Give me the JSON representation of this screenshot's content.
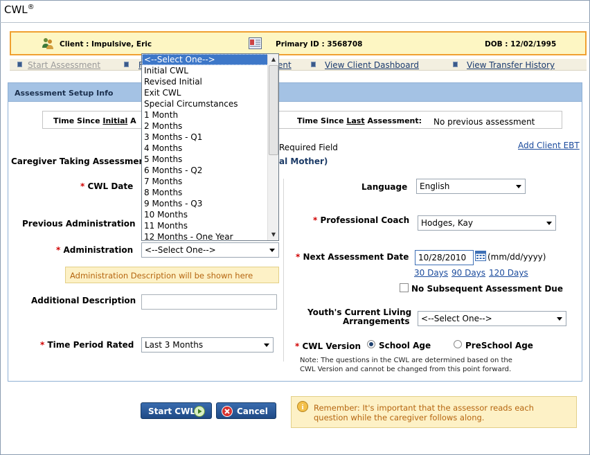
{
  "app": {
    "title": "CWL",
    "reg_mark": "®"
  },
  "client_bar": {
    "client_label": "Client : Impulsive, Eric",
    "primary_id_label": "Primary ID : 3568708",
    "dob_label": "DOB : 12/02/1995"
  },
  "nav": {
    "start_assessment": "Start Assessment",
    "item2_partial": "F",
    "item3_partial": "ent",
    "view_client_dashboard": "View Client Dashboard",
    "view_transfer_history": "View Transfer History"
  },
  "panel": {
    "header": "Assessment Setup Info"
  },
  "since": {
    "left_prefix": "Time Since",
    "left_link": "Initial",
    "left_rest": "A",
    "right_prefix": "Time Since",
    "right_link": "Last",
    "right_label": "Assessment:",
    "right_value": "No previous assessment"
  },
  "required_note": "Required Field",
  "add_client_ebt": "Add Client EBT",
  "caregiver": {
    "label": "Caregiver Taking Assessmen",
    "value_partial": "al Mother)"
  },
  "fields": {
    "cwl_date": "CWL Date",
    "previous_administration": "Previous Administration",
    "administration": "Administration",
    "administration_value": "<--Select One-->",
    "administration_description": "Administration Description will be shown here",
    "additional_description": "Additional Description",
    "time_period_rated": "Time Period Rated",
    "time_period_value": "Last 3 Months",
    "language": "Language",
    "language_value": "English",
    "professional_coach": "Professional Coach",
    "professional_coach_value": "Hodges, Kay",
    "next_assessment_date": "Next Assessment Date",
    "next_assessment_value": "10/28/2010",
    "date_format": "(mm/dd/yyyy)",
    "quick_30": "30 Days",
    "quick_90": "90 Days",
    "quick_120": "120 Days",
    "no_subsequent": "No Subsequent Assessment Due",
    "living_line1": "Youth's Current Living",
    "living_line2": "Arrangements",
    "living_value": "<--Select One-->",
    "cwl_version": "CWL Version",
    "school_age": "School Age",
    "preschool_age": "PreSchool Age",
    "note_line1": "Note: The questions in the CWL are determined based on the",
    "note_line2": "CWL Version and cannot be changed from this point forward."
  },
  "dropdown_options": [
    "<--Select One-->",
    "Initial CWL",
    "Revised Initial",
    "Exit CWL",
    "Special Circumstances",
    "1 Month",
    "2 Months",
    "3 Months - Q1",
    "4 Months",
    "5 Months",
    "6 Months - Q2",
    "7 Months",
    "8 Months",
    "9 Months - Q3",
    "10 Months",
    "11 Months",
    "12 Months - One Year"
  ],
  "buttons": {
    "start": "Start CWL",
    "cancel": "Cancel"
  },
  "remember": {
    "line1": "Remember: It's important that the assessor reads each",
    "line2": "question while the caregiver follows along."
  },
  "colors": {
    "accent": "#1f4a86",
    "required": "#d00000",
    "header_bg": "#a4c2e4",
    "highlight_border": "#f0a030"
  }
}
